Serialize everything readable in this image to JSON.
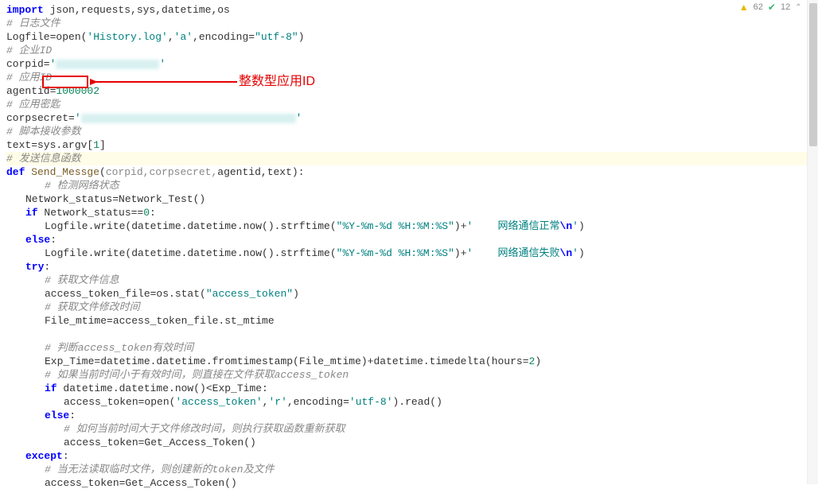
{
  "toolbar": {
    "warnings": "62",
    "checks": "12"
  },
  "annotation": {
    "text": "整数型应用ID",
    "boxed_value": "1000002"
  },
  "code": {
    "l1_kw": "import",
    "l1_rest": " json,requests,sys,datetime,os",
    "l2": "# 日志文件",
    "l3_a": "Logfile=open(",
    "l3_s1": "'History.log'",
    "l3_b": ",",
    "l3_s2": "'a'",
    "l3_c": ",encoding=",
    "l3_s3": "\"utf-8\"",
    "l3_d": ")",
    "l4": "# 企业ID",
    "l5_a": "corpid=",
    "l5_q": "'",
    "l5_end": "'",
    "l6": "# 应用ID",
    "l7_a": "agentid=",
    "l7_v": "1000002",
    "l8": "# 应用密匙",
    "l9_a": "corpsecret=",
    "l9_q": "'",
    "l9_end": "'",
    "l10": "# 脚本接收参数",
    "l11_a": "text=sys.argv[",
    "l11_n": "1",
    "l11_b": "]",
    "l12": "# 发送信息函数",
    "l13_kw": "def",
    "l13_fn": " Send_Messge",
    "l13_a": "(",
    "l13_p": "corpid,corpsecret,",
    "l13_b": "agentid,text):",
    "l14": "# 检测网络状态",
    "l15": "Network_status=Network_Test()",
    "l16_kw": "if",
    "l16_a": " Network_status==",
    "l16_n": "0",
    "l16_b": ":",
    "l17_a": "Logfile.write(datetime.datetime.now().strftime(",
    "l17_s": "\"%Y-%m-%d %H:%M:%S\"",
    "l17_b": ")+",
    "l17_s2": "'    网络通信正常",
    "l17_esc": "\\n",
    "l17_s3": "'",
    "l17_c": ")",
    "l18_kw": "else",
    "l18_a": ":",
    "l19_a": "Logfile.write(datetime.datetime.now().strftime(",
    "l19_s": "\"%Y-%m-%d %H:%M:%S\"",
    "l19_b": ")+",
    "l19_s2": "'    网络通信失败",
    "l19_esc": "\\n",
    "l19_s3": "'",
    "l19_c": ")",
    "l20_kw": "try",
    "l20_a": ":",
    "l21": "# 获取文件信息",
    "l22_a": "access_token_file=os.stat(",
    "l22_s": "\"access_token\"",
    "l22_b": ")",
    "l23": "# 获取文件修改时间",
    "l24": "File_mtime=access_token_file.st_mtime",
    "l25": "",
    "l26": "# 判断access_token有效时间",
    "l27_a": "Exp_Time=datetime.datetime.fromtimestamp(File_mtime)+datetime.timedelta(hours=",
    "l27_n": "2",
    "l27_b": ")",
    "l28": "# 如果当前时间小于有效时间，则直接在文件获取access_token",
    "l29_kw": "if",
    "l29_a": " datetime.datetime.now()<Exp_Time:",
    "l30_a": "access_token=open(",
    "l30_s1": "'access_token'",
    "l30_b": ",",
    "l30_s2": "'r'",
    "l30_c": ",encoding=",
    "l30_s3": "'utf-8'",
    "l30_d": ").read()",
    "l31_kw": "else",
    "l31_a": ":",
    "l32": "# 如何当前时间大于文件修改时间，则执行获取函数重新获取",
    "l33": "access_token=Get_Access_Token()",
    "l34_kw": "except",
    "l34_a": ":",
    "l35": "# 当无法读取临时文件，则创建新的token及文件",
    "l36": "access_token=Get_Access_Token()"
  }
}
